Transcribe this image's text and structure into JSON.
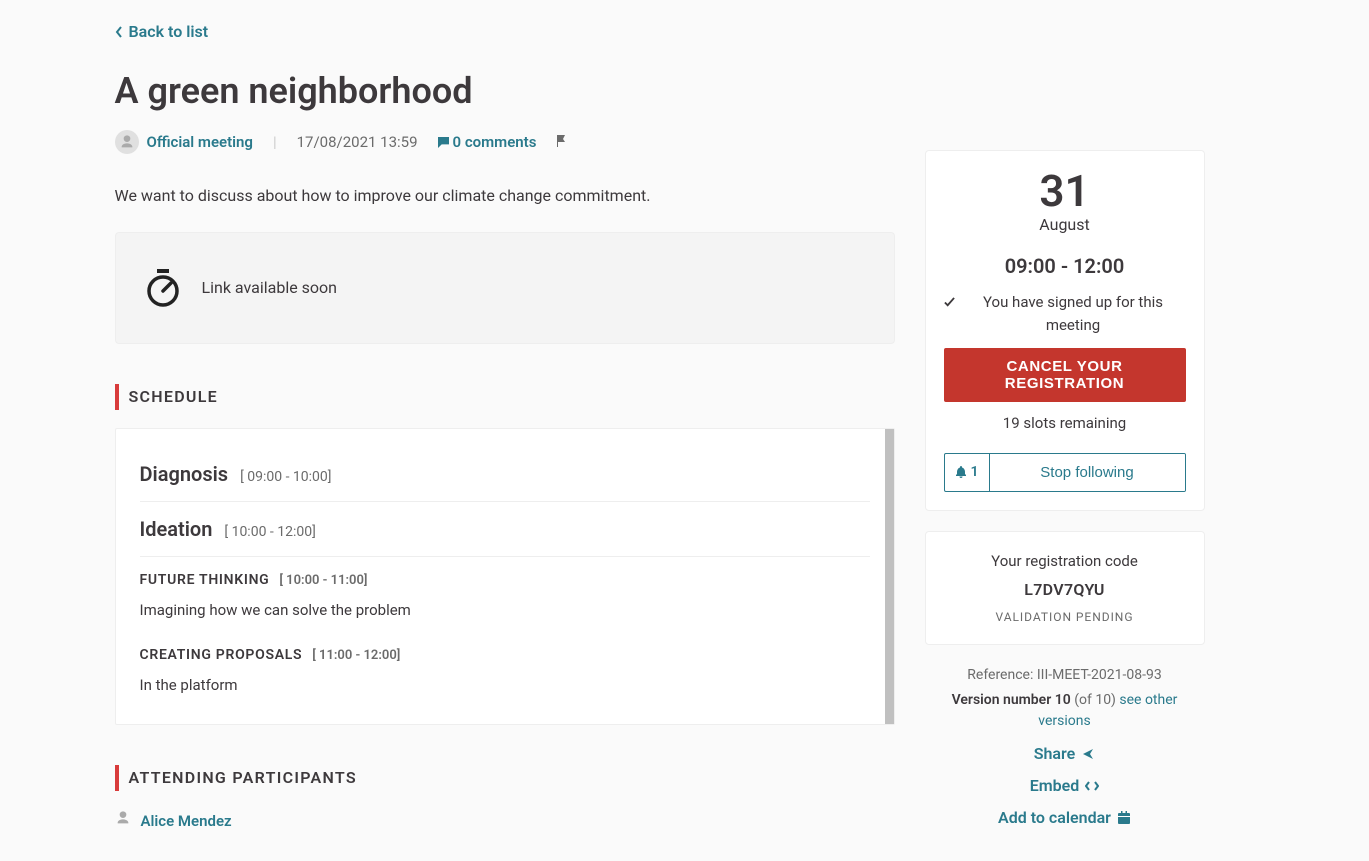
{
  "back_label": "Back to list",
  "title": "A green neighborhood",
  "author": "Official meeting",
  "date": "17/08/2021 13:59",
  "comments_label": "0 comments",
  "description": "We want to discuss about how to improve our climate change commitment.",
  "link_box": "Link available soon",
  "schedule_heading": "SCHEDULE",
  "schedule": {
    "diagnosis": {
      "title": "Diagnosis",
      "time": "[ 09:00 - 10:00]"
    },
    "ideation": {
      "title": "Ideation",
      "time": "[ 10:00 - 12:00]"
    },
    "future": {
      "title": "FUTURE THINKING",
      "time": "[ 10:00 - 11:00]",
      "desc": "Imagining how we can solve the problem"
    },
    "proposals": {
      "title": "CREATING PROPOSALS",
      "time": "[ 11:00 - 12:00]",
      "desc": "In the platform"
    }
  },
  "participants_heading": "ATTENDING PARTICIPANTS",
  "participant_name": "Alice Mendez",
  "sidebar": {
    "day": "31",
    "month": "August",
    "time": "09:00 - 12:00",
    "signed_up": "You have signed up for this meeting",
    "cancel_label": "CANCEL YOUR REGISTRATION",
    "slots": "19 slots remaining",
    "follow_count": "1",
    "follow_label": "Stop following",
    "reg_code_label": "Your registration code",
    "reg_code": "L7DV7QYU",
    "reg_status": "VALIDATION PENDING",
    "reference_prefix": "Reference: ",
    "reference": "III-MEET-2021-08-93",
    "version_label": "Version number 10",
    "version_total": " (of 10) ",
    "see_other": "see other versions",
    "share": "Share",
    "embed": "Embed",
    "add_calendar": "Add to calendar"
  }
}
